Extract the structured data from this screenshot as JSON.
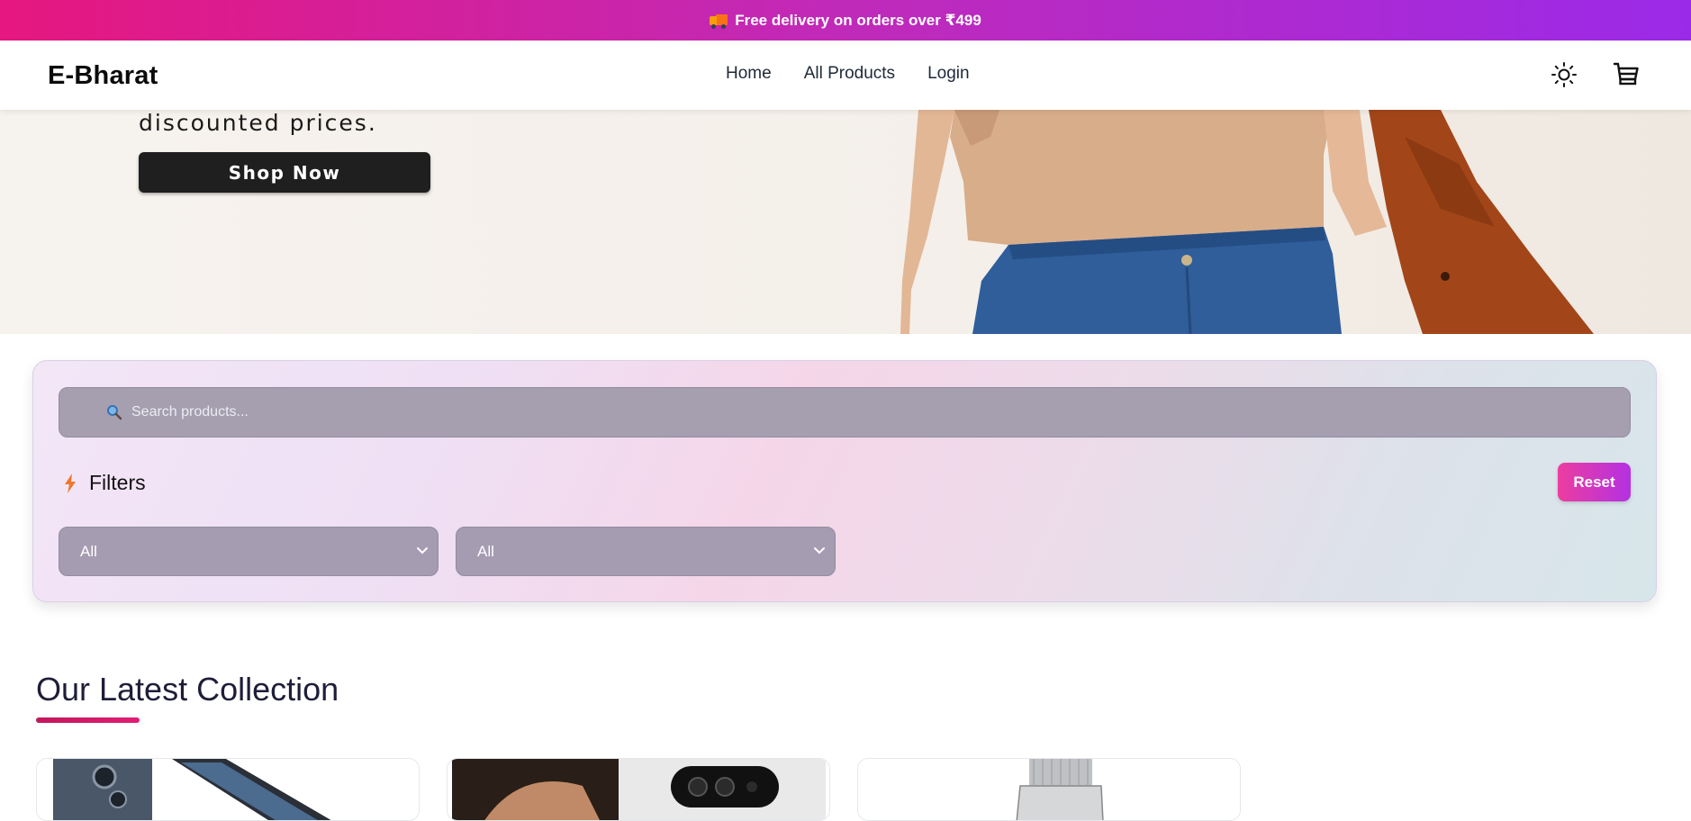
{
  "announcement": {
    "text": "Free delivery on orders over ₹499"
  },
  "navbar": {
    "brand": "E-Bharat",
    "links": [
      "Home",
      "All Products",
      "Login"
    ]
  },
  "hero": {
    "tagline": "discounted prices.",
    "cta_label": "Shop Now"
  },
  "filters": {
    "search_placeholder": "Search products...",
    "title": "Filters",
    "reset_label": "Reset",
    "category_selected": "All",
    "price_selected": "All"
  },
  "collection": {
    "title": "Our Latest Collection",
    "products": [
      {
        "icon": "phone-product-image"
      },
      {
        "icon": "phone-camera-product-image"
      },
      {
        "icon": "watch-product-image"
      }
    ]
  },
  "colors": {
    "accent_pink": "#e6177f",
    "accent_purple": "#9b2ae8",
    "reset_gradient_start": "#ec3da0",
    "reset_gradient_end": "#b431e2",
    "underline": "#c2185b"
  }
}
